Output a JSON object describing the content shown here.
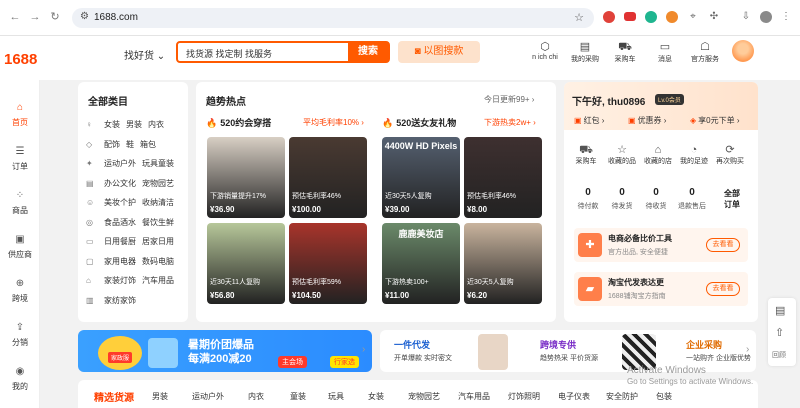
{
  "browser": {
    "url": "1688.com"
  },
  "header": {
    "logo": "1688",
    "search_mode": "找好货 ⌄",
    "search_placeholder": "找货源 找定制 找服务",
    "search_button": "搜索",
    "image_search": "以图搜款",
    "icons": [
      {
        "label": "n ich chi",
        "icon": "box-icon"
      },
      {
        "label": "我的采购",
        "icon": "bag-icon"
      },
      {
        "label": "采购车",
        "icon": "cart-icon"
      },
      {
        "label": "消息",
        "icon": "chat-icon"
      },
      {
        "label": "官方服务",
        "icon": "service-icon"
      }
    ]
  },
  "left_nav": [
    {
      "label": "首页",
      "icon": "⌂"
    },
    {
      "label": "订单",
      "icon": "☰"
    },
    {
      "label": "商品",
      "icon": "⁘"
    },
    {
      "label": "供应商",
      "icon": "▣"
    },
    {
      "label": "跨境",
      "icon": "⊕"
    },
    {
      "label": "分销",
      "icon": "⇪"
    },
    {
      "label": "我的",
      "icon": "◉"
    }
  ],
  "categories": {
    "title": "全部类目",
    "rows": [
      {
        "icon": "♀",
        "a": "女装",
        "b": "男装",
        "c": "内衣"
      },
      {
        "icon": "◇",
        "a": "配饰",
        "b": "鞋",
        "c": "箱包"
      },
      {
        "icon": "✦",
        "a": "运动户外",
        "b": "玩具童装",
        "c": ""
      },
      {
        "icon": "▤",
        "a": "办公文化",
        "b": "宠物园艺",
        "c": ""
      },
      {
        "icon": "☺",
        "a": "美妆个护",
        "b": "收纳清洁",
        "c": ""
      },
      {
        "icon": "◎",
        "a": "食品酒水",
        "b": "餐饮生鲜",
        "c": ""
      },
      {
        "icon": "▭",
        "a": "日用餐厨",
        "b": "居家日用",
        "c": ""
      },
      {
        "icon": "▢",
        "a": "家用电器",
        "b": "数码电脑",
        "c": ""
      },
      {
        "icon": "⌂",
        "a": "家装灯饰",
        "b": "汽车用品",
        "c": ""
      },
      {
        "icon": "▥",
        "a": "家纺家饰",
        "b": "",
        "c": ""
      }
    ]
  },
  "trends": {
    "title": "趋势热点",
    "more": "今日更新99+ ›",
    "groups": [
      {
        "title": "520约会穿搭",
        "right": "平均毛利率10% ›",
        "tiles": [
          {
            "caption": "下游销量提升17%",
            "price": "¥36.90",
            "banner": ""
          },
          {
            "caption": "预估毛利率46%",
            "price": "¥100.00",
            "banner": ""
          },
          {
            "caption": "近30天11人复购",
            "price": "¥56.80",
            "banner": ""
          },
          {
            "caption": "预估毛利率59%",
            "price": "¥104.50",
            "banner": ""
          }
        ]
      },
      {
        "title": "520送女友礼物",
        "right": "下游热卖2w+ ›",
        "tiles": [
          {
            "caption": "近30天5人复购",
            "price": "¥39.00",
            "banner": "4400W HD Pixels"
          },
          {
            "caption": "预估毛利率46%",
            "price": "¥8.00",
            "banner": ""
          },
          {
            "caption": "下游热卖100+",
            "price": "¥11.00",
            "banner": "鹿鹿美妆店"
          },
          {
            "caption": "近30天5人复购",
            "price": "¥6.20",
            "banner": ""
          }
        ]
      }
    ]
  },
  "user": {
    "greeting": "下午好, thu0896",
    "level": "Lv.0会员",
    "chips": [
      "红包 ›",
      "优惠券 ›",
      "享0元下单 ›"
    ],
    "icons": [
      "采购车",
      "收藏的品",
      "收藏的店",
      "我的足迹",
      "再次购买"
    ],
    "orders": [
      {
        "count": "0",
        "label": "待付款"
      },
      {
        "count": "0",
        "label": "待发货"
      },
      {
        "count": "0",
        "label": "待收货"
      },
      {
        "count": "0",
        "label": "退款售后"
      }
    ],
    "all_orders": "全部\n订单",
    "promos": [
      {
        "title": "电商必备比价工具",
        "sub": "官方出品, 安全便捷",
        "button": "去看看"
      },
      {
        "title": "淘宝代发表达更",
        "sub": "1688铺淘宝方指南",
        "button": "去看看"
      }
    ]
  },
  "banners": {
    "promo1": "暑期价团爆品",
    "promo2": "每满200减20",
    "btn_main": "主会场",
    "btn_sub": "行家选",
    "tag": "家政服",
    "items": [
      {
        "title": "一件代发",
        "sub": "开单爆款 实时密文",
        "color": "#1a5fd1"
      },
      {
        "title": "跨境专供",
        "sub": "趋势热采 平价货源",
        "color": "#7a2ec7"
      },
      {
        "title": "企业采购",
        "sub": "一站购齐 企业版优势",
        "color": "#e06b00"
      }
    ]
  },
  "tabs": [
    "精选货源",
    "男装",
    "运动户外",
    "内衣",
    "童装",
    "玩具",
    "女装",
    "宠物园艺",
    "汽车用品",
    "灯饰照明",
    "电子仪表",
    "安全防护",
    "包装"
  ],
  "float_label": "回顾",
  "watermark": {
    "title": "Activate Windows",
    "sub": "Go to Settings to activate Windows."
  }
}
